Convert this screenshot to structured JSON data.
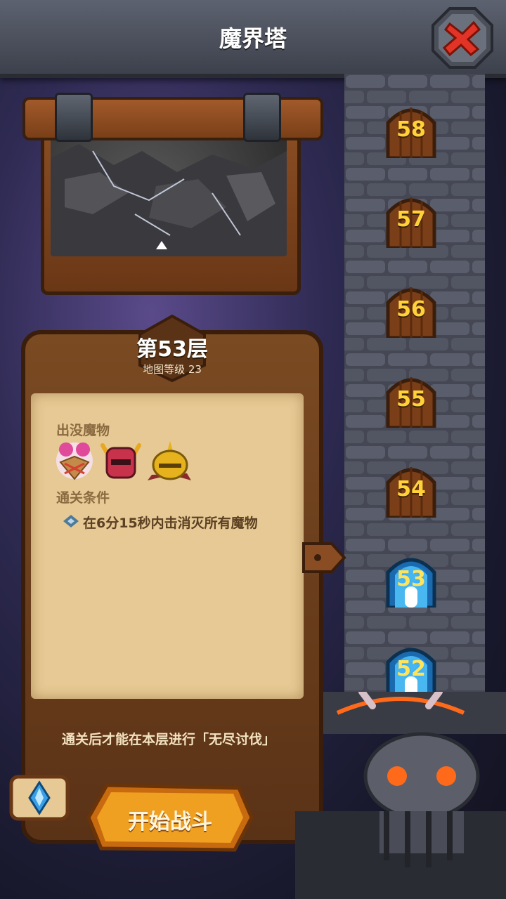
{
  "header": {
    "title": "魔界塔",
    "close_icon": "close-x-icon"
  },
  "level_info": {
    "floor_label": "第53层",
    "map_level": "地图等级 23",
    "monsters_heading": "出没魔物",
    "monsters": [
      {
        "name": "flower-cake-monster-icon",
        "color": "#e04a9a"
      },
      {
        "name": "red-horned-knight-icon",
        "color": "#c8324a"
      },
      {
        "name": "gold-spiked-helmet-icon",
        "color": "#e6b21e"
      }
    ],
    "condition_heading": "通关条件",
    "condition": "在6分15秒内击消灭所有魔物",
    "note": "通关后才能在本层进行「无尽讨伐」"
  },
  "actions": {
    "start_battle": "开始战斗",
    "scroll_icon": "crystal-scroll-icon"
  },
  "tower": {
    "floors": [
      {
        "number": "58",
        "state": "locked"
      },
      {
        "number": "57",
        "state": "locked"
      },
      {
        "number": "56",
        "state": "locked"
      },
      {
        "number": "55",
        "state": "locked"
      },
      {
        "number": "54",
        "state": "locked"
      },
      {
        "number": "53",
        "state": "current"
      },
      {
        "number": "52",
        "state": "cleared"
      }
    ],
    "selected": "53"
  },
  "colors": {
    "accent": "#f0a020",
    "gold": "#ffd23a",
    "wood": "#7a4a22",
    "parchment": "#e6c994"
  }
}
